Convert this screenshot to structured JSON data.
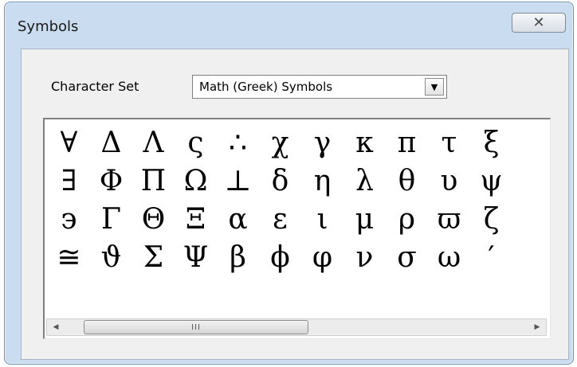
{
  "window": {
    "title": "Symbols",
    "close_glyph": "✕"
  },
  "character_set": {
    "label": "Character Set",
    "value": "Math (Greek) Symbols",
    "arrow": "▼"
  },
  "symbols": [
    "∀",
    "Δ",
    "Λ",
    "ς",
    "∴",
    "χ",
    "γ",
    "κ",
    "π",
    "τ",
    "ξ",
    "∃",
    "Φ",
    "Π",
    "Ω",
    "⊥",
    "δ",
    "η",
    "λ",
    "θ",
    "υ",
    "ψ",
    "϶",
    "Γ",
    "Θ",
    "Ξ",
    "α",
    "ε",
    "ι",
    "μ",
    "ρ",
    "ϖ",
    "ζ",
    "≅",
    "ϑ",
    "Σ",
    "Ψ",
    "β",
    "ϕ",
    "φ",
    "ν",
    "σ",
    "ω",
    "′"
  ],
  "scrollbar": {
    "left_arrow": "◀",
    "right_arrow": "▶",
    "grip": "III"
  }
}
